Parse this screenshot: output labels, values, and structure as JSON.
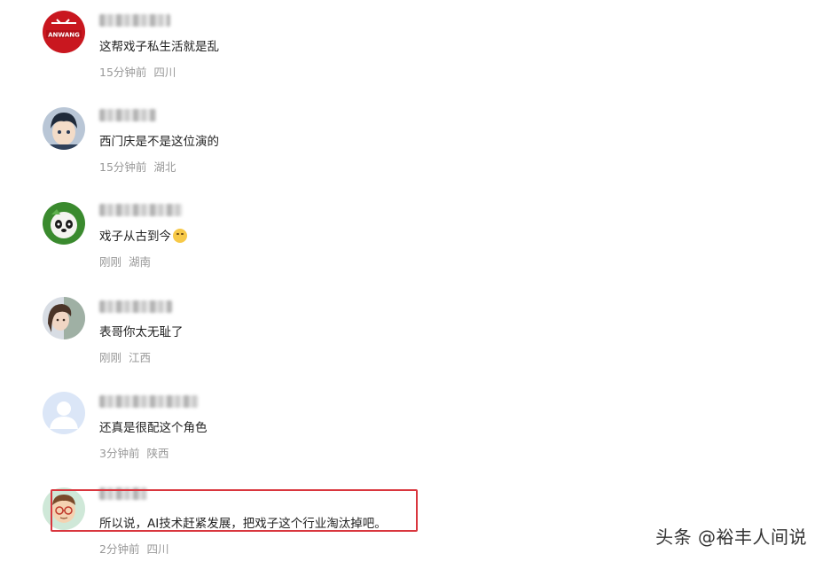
{
  "comments": [
    {
      "text": "这帮戏子私生活就是乱",
      "time": "15分钟前",
      "location": "四川",
      "avatar_icon": "red-badge-avatar-icon",
      "avatar_text": "ANWANG"
    },
    {
      "text": "西门庆是不是这位演的",
      "time": "15分钟前",
      "location": "湖北",
      "avatar_icon": "anime-boy-avatar-icon"
    },
    {
      "text": "戏子从古到今",
      "emoji": "blushing-face-emoji",
      "time": "刚刚",
      "location": "湖南",
      "avatar_icon": "panda-avatar-icon"
    },
    {
      "text": "表哥你太无耻了",
      "time": "刚刚",
      "location": "江西",
      "avatar_icon": "photo-girl-avatar-icon"
    },
    {
      "text": "还真是很配这个角色",
      "time": "3分钟前",
      "location": "陕西",
      "avatar_icon": "default-user-avatar-icon"
    },
    {
      "text": "所以说，AI技术赶紧发展，把戏子这个行业淘汰掉吧。",
      "time": "2分钟前",
      "location": "四川",
      "avatar_icon": "cartoon-glasses-avatar-icon"
    }
  ],
  "highlight_color": "#d9363e",
  "watermark": "头条 @裕丰人间说"
}
